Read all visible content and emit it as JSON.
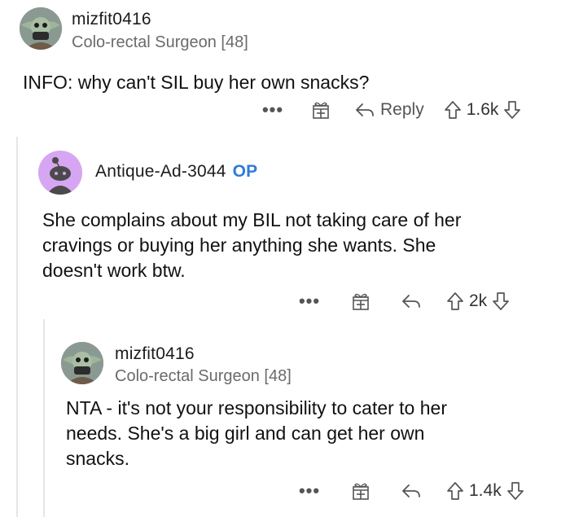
{
  "comments": [
    {
      "username": "mizfit0416",
      "flair": "Colo-rectal Surgeon [48]",
      "body": [
        "INFO:  why can't SIL buy her own snacks?"
      ],
      "actions": {
        "more": "•••",
        "reply": "Reply",
        "score": "1.6k"
      }
    },
    {
      "username": "Antique-Ad-3044",
      "op_badge": "OP",
      "body": [
        "She complains about my BIL not taking care of her",
        "cravings or buying her anything she wants. She",
        "doesn't work btw."
      ],
      "actions": {
        "more": "•••",
        "score": "2k"
      }
    },
    {
      "username": "mizfit0416",
      "flair": "Colo-rectal Surgeon [48]",
      "body": [
        "NTA - it's not your responsibility to cater to her",
        "needs.  She's a big girl and can get her own",
        "snacks."
      ],
      "actions": {
        "more": "•••",
        "score": "1.4k"
      }
    }
  ],
  "colors": {
    "op_badge": "#2f7bd8",
    "avatar_purple": "#d6a6f2",
    "text_gray": "#6b6b6b"
  }
}
